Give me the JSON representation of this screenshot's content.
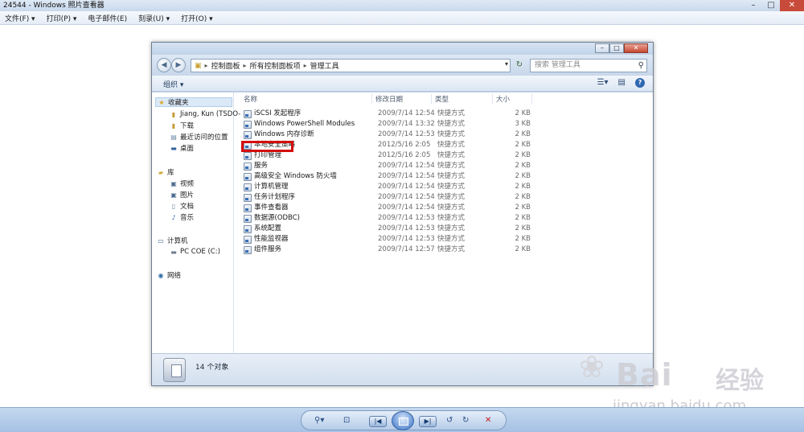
{
  "viewer": {
    "title": "24544 - Windows 照片查看器",
    "menu": [
      "文件(F) ▾",
      "打印(P) ▾",
      "电子邮件(E)",
      "刻录(U) ▾",
      "打开(O) ▾"
    ]
  },
  "explorer": {
    "breadcrumb": [
      "控制面板",
      "所有控制面板项",
      "管理工具"
    ],
    "search_placeholder": "搜索 管理工具",
    "organize_label": "组织 ▾",
    "nav": {
      "favorites": {
        "label": "收藏夹",
        "items": [
          "Jiang, Kun (TSDO-",
          "下载",
          "最近访问的位置",
          "桌面"
        ]
      },
      "libraries": {
        "label": "库",
        "items": [
          "视频",
          "图片",
          "文档",
          "音乐"
        ]
      },
      "computer": {
        "label": "计算机",
        "items": [
          "PC COE (C:)"
        ]
      },
      "network": {
        "label": "网络"
      }
    },
    "columns": {
      "name": "名称",
      "date": "修改日期",
      "type": "类型",
      "size": "大小"
    },
    "files": [
      {
        "name": "iSCSI 发起程序",
        "date": "2009/7/14 12:54",
        "type": "快捷方式",
        "size": "2 KB"
      },
      {
        "name": "Windows PowerShell Modules",
        "date": "2009/7/14 13:32",
        "type": "快捷方式",
        "size": "3 KB"
      },
      {
        "name": "Windows 内存诊断",
        "date": "2009/7/14 12:53",
        "type": "快捷方式",
        "size": "2 KB"
      },
      {
        "name": "本地安全策略",
        "date": "2012/5/16 2:05",
        "type": "快捷方式",
        "size": "2 KB"
      },
      {
        "name": "打印管理",
        "date": "2012/5/16 2:05",
        "type": "快捷方式",
        "size": "2 KB"
      },
      {
        "name": "服务",
        "date": "2009/7/14 12:54",
        "type": "快捷方式",
        "size": "2 KB"
      },
      {
        "name": "高级安全 Windows 防火墙",
        "date": "2009/7/14 12:54",
        "type": "快捷方式",
        "size": "2 KB"
      },
      {
        "name": "计算机管理",
        "date": "2009/7/14 12:54",
        "type": "快捷方式",
        "size": "2 KB"
      },
      {
        "name": "任务计划程序",
        "date": "2009/7/14 12:54",
        "type": "快捷方式",
        "size": "2 KB"
      },
      {
        "name": "事件查看器",
        "date": "2009/7/14 12:54",
        "type": "快捷方式",
        "size": "2 KB"
      },
      {
        "name": "数据源(ODBC)",
        "date": "2009/7/14 12:53",
        "type": "快捷方式",
        "size": "2 KB"
      },
      {
        "name": "系统配置",
        "date": "2009/7/14 12:53",
        "type": "快捷方式",
        "size": "2 KB"
      },
      {
        "name": "性能监视器",
        "date": "2009/7/14 12:53",
        "type": "快捷方式",
        "size": "2 KB"
      },
      {
        "name": "组件服务",
        "date": "2009/7/14 12:57",
        "type": "快捷方式",
        "size": "2 KB"
      }
    ],
    "status": "14 个对象"
  },
  "watermark": {
    "brand": "Bai",
    "cn": "经验",
    "url": "jingyan.baidu.com"
  },
  "colors": {
    "highlight": "#d50d0d",
    "accent": "#3771c4"
  }
}
